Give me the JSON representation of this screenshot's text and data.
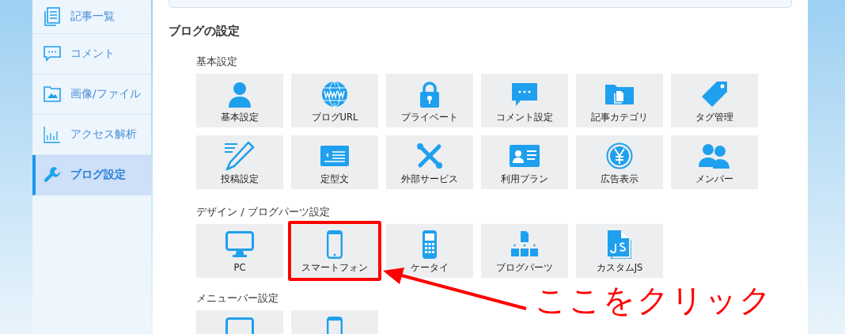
{
  "sidebar": {
    "items": [
      {
        "label": "記事一覧",
        "kind": "document",
        "selected": false
      },
      {
        "label": "コメント",
        "kind": "comment",
        "selected": false
      },
      {
        "label": "画像/ファイル",
        "kind": "image",
        "selected": false
      },
      {
        "label": "アクセス解析",
        "kind": "chart",
        "selected": false
      },
      {
        "label": "ブログ設定",
        "kind": "wrench",
        "selected": true
      }
    ]
  },
  "main": {
    "title": "ブログの設定",
    "sections": [
      {
        "title": "基本設定",
        "tiles": [
          {
            "label": "基本設定",
            "kind": "person",
            "highlighted": false
          },
          {
            "label": "ブログURL",
            "kind": "globe",
            "highlighted": false
          },
          {
            "label": "プライベート",
            "kind": "lock",
            "highlighted": false
          },
          {
            "label": "コメント設定",
            "kind": "comment",
            "highlighted": false
          },
          {
            "label": "記事カテゴリ",
            "kind": "folder",
            "highlighted": false
          },
          {
            "label": "タグ管理",
            "kind": "tag",
            "highlighted": false
          },
          {
            "label": "投稿設定",
            "kind": "pencil",
            "highlighted": false
          },
          {
            "label": "定型文",
            "kind": "template",
            "highlighted": false
          },
          {
            "label": "外部サービス",
            "kind": "tools",
            "highlighted": false
          },
          {
            "label": "利用プラン",
            "kind": "card",
            "highlighted": false
          },
          {
            "label": "広告表示",
            "kind": "yen",
            "highlighted": false
          },
          {
            "label": "メンバー",
            "kind": "people",
            "highlighted": false
          }
        ]
      },
      {
        "title": "デザイン / ブログパーツ設定",
        "tiles": [
          {
            "label": "PC",
            "kind": "monitor",
            "highlighted": false
          },
          {
            "label": "スマートフォン",
            "kind": "phone",
            "highlighted": true
          },
          {
            "label": "ケータイ",
            "kind": "keypad",
            "highlighted": false
          },
          {
            "label": "ブログパーツ",
            "kind": "parts",
            "highlighted": false
          },
          {
            "label": "カスタムJS",
            "kind": "js",
            "highlighted": false
          }
        ]
      },
      {
        "title": "メニューバー設定",
        "tiles": [
          {
            "kind": "monitor",
            "highlighted": false
          },
          {
            "kind": "phone",
            "highlighted": false
          }
        ]
      }
    ]
  },
  "callout": {
    "text": "ここをクリック"
  }
}
